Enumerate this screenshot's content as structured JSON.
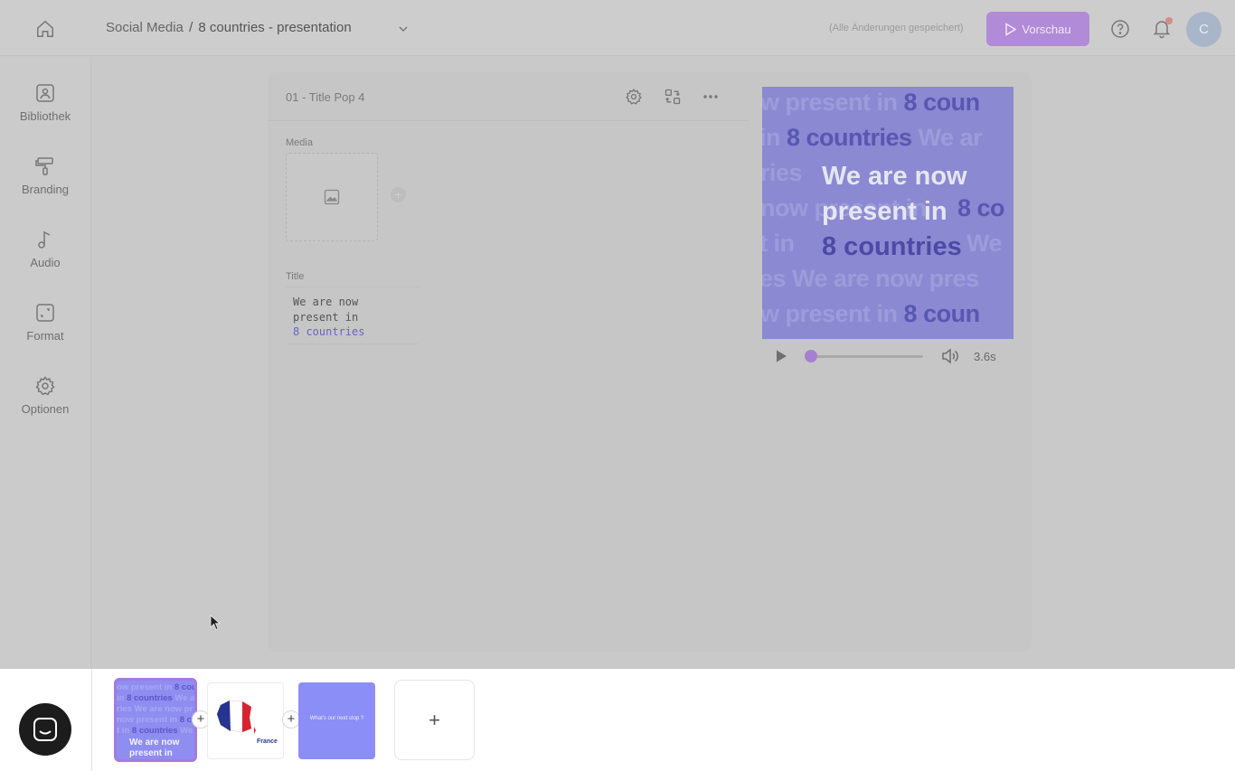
{
  "header": {
    "breadcrumb_parent": "Social Media",
    "breadcrumb_separator": "/",
    "breadcrumb_project": "8 countries - presentation",
    "saved_status": "(Alle Änderungen gespeichert)",
    "preview_label": "Vorschau",
    "avatar_initial": "C",
    "accent_color": "#b18ad8"
  },
  "sidebar": {
    "items": [
      {
        "label": "Bibliothek",
        "icon": "library-image-icon"
      },
      {
        "label": "Branding",
        "icon": "paint-roller-icon"
      },
      {
        "label": "Audio",
        "icon": "music-note-icon"
      },
      {
        "label": "Format",
        "icon": "resize-icon"
      },
      {
        "label": "Optionen",
        "icon": "gear-icon"
      }
    ]
  },
  "editor": {
    "scene_title": "01 - Title Pop 4",
    "media_label": "Media",
    "title_label": "Title",
    "title_lines": [
      "We are now",
      "present in",
      "8 countries"
    ]
  },
  "preview": {
    "bg_rows": [
      [
        "w present in ",
        "8 coun"
      ],
      [
        "in ",
        "8 countries",
        " We ar"
      ],
      [
        "ries ",
        "",
        "We are now pr"
      ],
      [
        "now present in ",
        "8 co"
      ],
      [
        "t in ",
        "8 countries",
        " We"
      ],
      [
        "es We are now pres",
        ""
      ],
      [
        "w present in ",
        "8 coun"
      ]
    ],
    "line1": "We are now",
    "line2": "present in",
    "line3": "8 countries",
    "time": "3.6s",
    "progress": 0.0
  },
  "timeline": {
    "scene1_caption_line1": "We are now",
    "scene1_caption_line2": "present in",
    "scene1_bg": [
      "ow present in ",
      "8 cou",
      "in ",
      "8 countries",
      " We ar",
      "ries We are now pr",
      "now present in ",
      "8 co",
      "t in ",
      "8 countries",
      " We"
    ],
    "scene2_caption": "France",
    "scene3_caption": "What's our next stop ?",
    "add_symbol": "+"
  }
}
